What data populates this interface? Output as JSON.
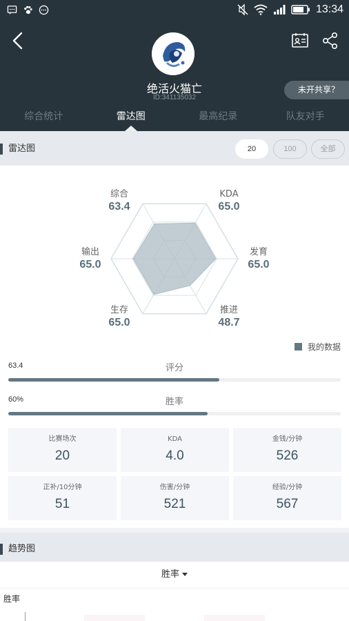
{
  "status_bar": {
    "time": "13:34"
  },
  "profile": {
    "nickname": "绝活火猫亡",
    "uid": "ID:341135032",
    "share_label": "未开共享？"
  },
  "tabs": [
    {
      "label": "综合统计"
    },
    {
      "label": "雷达图"
    },
    {
      "label": "最高纪录"
    },
    {
      "label": "队友对手"
    }
  ],
  "radar_section": {
    "title": "雷达图",
    "range_options": [
      "20",
      "100",
      "全部"
    ],
    "selected_range": "20"
  },
  "radar": {
    "axes": [
      {
        "name": "综合",
        "value": "63.4"
      },
      {
        "name": "KDA",
        "value": "65.0"
      },
      {
        "name": "发育",
        "value": "65.0"
      },
      {
        "name": "推进",
        "value": "48.7"
      },
      {
        "name": "生存",
        "value": "65.0"
      },
      {
        "name": "输出",
        "value": "65.0"
      }
    ],
    "max": 100,
    "legend": "我的数据",
    "colors": {
      "fill": "#aebcc4",
      "grid": "#d7e1e6",
      "accent": "#647883"
    }
  },
  "bars": [
    {
      "name": "评分",
      "value_text": "63.4",
      "fraction": 0.634
    },
    {
      "name": "胜率",
      "value_text": "60%",
      "fraction": 0.6
    }
  ],
  "stats": [
    {
      "label": "比赛场次",
      "value": "20"
    },
    {
      "label": "KDA",
      "value": "4.0"
    },
    {
      "label": "金钱/分钟",
      "value": "526"
    },
    {
      "label": "正补/10分钟",
      "value": "51"
    },
    {
      "label": "伤害/分钟",
      "value": "521"
    },
    {
      "label": "经验/分钟",
      "value": "567"
    }
  ],
  "trend_section": {
    "title": "趋势图",
    "selector": "胜率",
    "y_label": "胜率"
  }
}
